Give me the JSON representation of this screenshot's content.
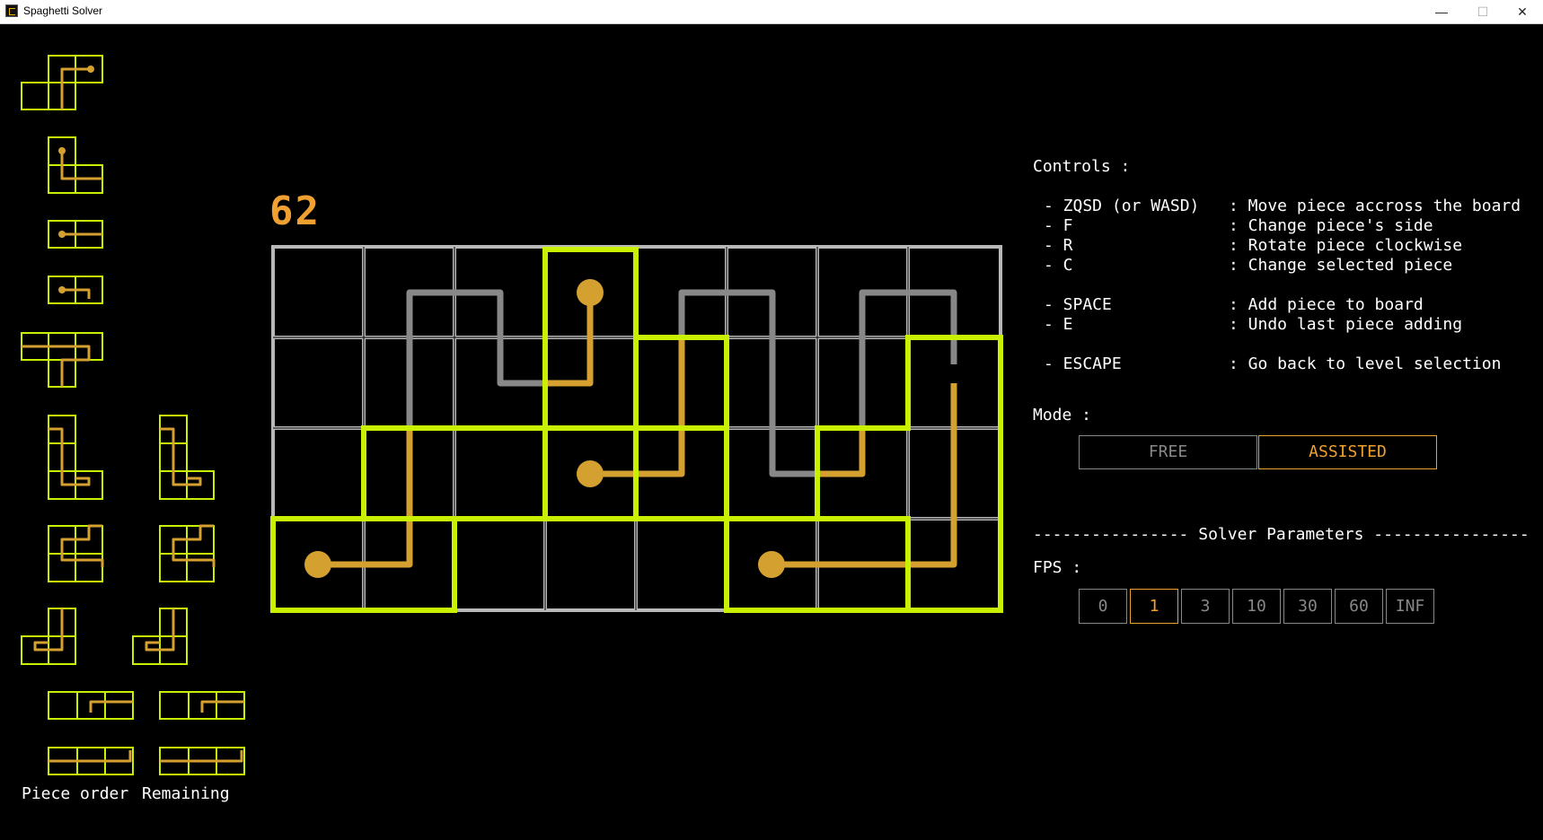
{
  "window": {
    "title": "Spaghetti Solver"
  },
  "window_controls": {
    "minimize": "—",
    "maximize": "☐",
    "close": "✕"
  },
  "score": "62",
  "left_panel": {
    "piece_order_label": "Piece order",
    "remaining_label": "Remaining"
  },
  "controls": {
    "header": "Controls :",
    "items": [
      {
        "key": "- ZQSD (or WASD)",
        "desc": ": Move piece accross the board"
      },
      {
        "key": "- F",
        "desc": ": Change piece's side"
      },
      {
        "key": "- R",
        "desc": ": Rotate piece clockwise"
      },
      {
        "key": "- C",
        "desc": ": Change selected piece"
      },
      {
        "key": "- SPACE",
        "desc": ": Add piece to board"
      },
      {
        "key": "- E",
        "desc": ": Undo last piece adding"
      },
      {
        "key": "- ESCAPE",
        "desc": ": Go back to level selection"
      }
    ]
  },
  "mode": {
    "label": "Mode :",
    "options": [
      "FREE",
      "ASSISTED"
    ],
    "selected": "ASSISTED"
  },
  "solver": {
    "header": "---------------- Solver Parameters ----------------",
    "fps_label": "FPS :",
    "fps_options": [
      "0",
      "1",
      "3",
      "10",
      "30",
      "60",
      "INF"
    ],
    "fps_selected": "1"
  },
  "colors": {
    "background": "#000000",
    "grid": "#c8c8c8",
    "piece_outline": "#c8f000",
    "path_placed": "#d4a030",
    "path_hint": "#888888",
    "accent": "#f0a030"
  }
}
